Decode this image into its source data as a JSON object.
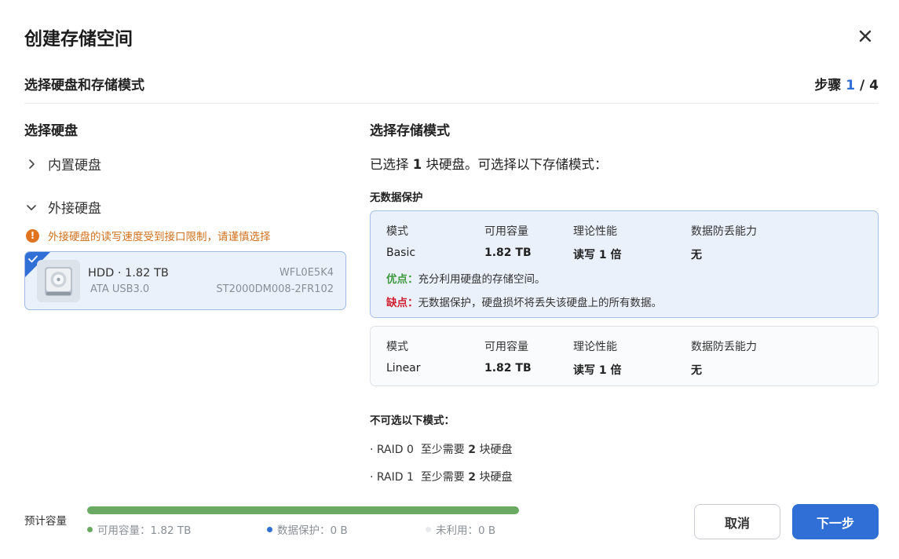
{
  "dialog": {
    "title": "创建存储空间",
    "subtitle": "选择硬盘和存储模式",
    "step_prefix": "步骤 ",
    "step_current": "1",
    "step_total": " / 4"
  },
  "left": {
    "title": "选择硬盘",
    "internal_label": "内置硬盘",
    "external_label": "外接硬盘",
    "warning": "外接硬盘的读写速度受到接口限制，请谨慎选择",
    "disk": {
      "name": "HDD · 1.82 TB",
      "interface": "ATA USB3.0",
      "serial": "WFL0E5K4",
      "model": "ST2000DM008-2FR102"
    }
  },
  "right": {
    "title": "选择存储模式",
    "lead_prefix": "已选择 ",
    "lead_count": "1",
    "lead_suffix": " 块硬盘。可选择以下存储模式：",
    "group_label": "无数据保护",
    "headers": {
      "mode": "模式",
      "capacity": "可用容量",
      "performance": "理论性能",
      "protection": "数据防丢能力"
    },
    "modes": [
      {
        "name": "Basic",
        "capacity": "1.82 TB",
        "performance": "读写 1 倍",
        "protection": "无",
        "pro_key": "优点：",
        "pro_text": "充分利用硬盘的存储空间。",
        "con_key": "缺点：",
        "con_text": "无数据保护，硬盘损坏将丢失该硬盘上的所有数据。"
      },
      {
        "name": "Linear",
        "capacity": "1.82 TB",
        "performance": "读写 1 倍",
        "protection": "无"
      }
    ],
    "unavailable_label": "不可选以下模式：",
    "unavailable": [
      {
        "name": "· RAID 0",
        "req_prefix": "至少需要 ",
        "req_count": "2",
        "req_suffix": " 块硬盘"
      },
      {
        "name": "· RAID 1",
        "req_prefix": "至少需要 ",
        "req_count": "2",
        "req_suffix": " 块硬盘"
      }
    ]
  },
  "footer": {
    "capacity_label": "预计容量",
    "available_fraction": 1.0,
    "legend": [
      {
        "label": "可用容量：1.82 TB",
        "color": "#6aaa62"
      },
      {
        "label": "数据保护：0 B",
        "color": "#2f6fd6"
      },
      {
        "label": "未利用：0 B",
        "color": "#e8eaed"
      }
    ],
    "cancel_label": "取消",
    "next_label": "下一步"
  },
  "colors": {
    "accent": "#2f6fd6",
    "success": "#6aaa62",
    "warning": "#e0731f",
    "danger": "#d02030"
  },
  "icons": {
    "close": "close-icon",
    "chevron_right": "chevron-right-icon",
    "chevron_down": "chevron-down-icon",
    "warning": "warning-icon",
    "check": "check-icon",
    "disk": "hard-disk-icon"
  }
}
